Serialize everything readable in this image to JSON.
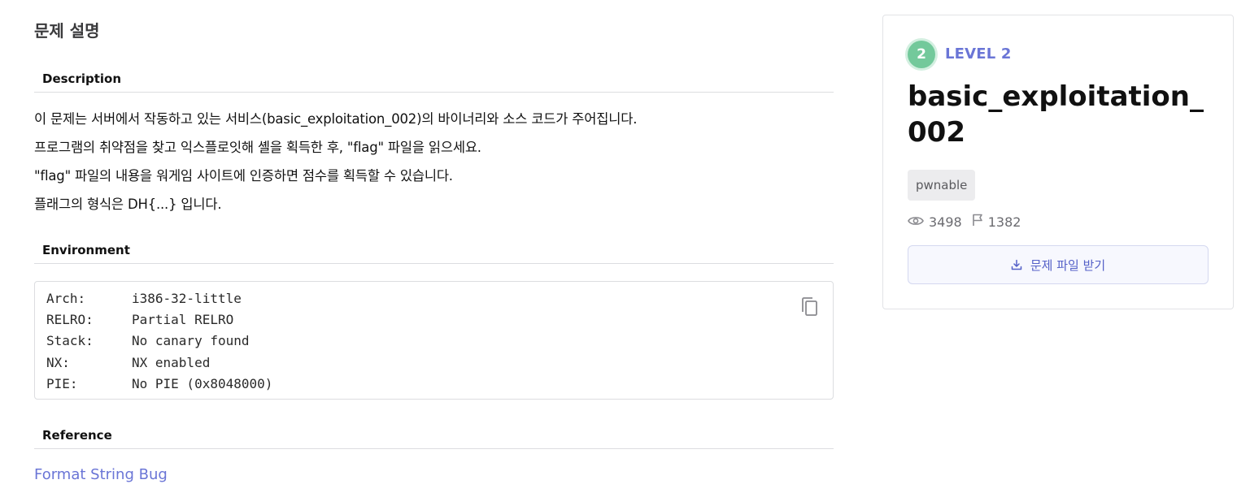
{
  "page": {
    "title": "문제 설명"
  },
  "sections": {
    "description_heading": "Description",
    "environment_heading": "Environment",
    "reference_heading": "Reference"
  },
  "description": [
    "이 문제는 서버에서 작동하고 있는 서비스(basic_exploitation_002)의 바이너리와 소스 코드가 주어집니다.",
    "프로그램의 취약점을 찾고 익스플로잇해 셸을 획득한 후, \"flag\" 파일을 읽으세요.",
    "\"flag\" 파일의 내용을 워게임 사이트에 인증하면 점수를 획득할 수 있습니다.",
    "플래그의 형식은 DH{...} 입니다."
  ],
  "environment": [
    {
      "key": "Arch:",
      "value": "i386-32-little"
    },
    {
      "key": "RELRO:",
      "value": "Partial RELRO"
    },
    {
      "key": "Stack:",
      "value": "No canary found"
    },
    {
      "key": "NX:",
      "value": "NX enabled"
    },
    {
      "key": "PIE:",
      "value": "No PIE (0x8048000)"
    }
  ],
  "reference": {
    "link_text": "Format String Bug"
  },
  "card": {
    "level_number": "2",
    "level_label": "LEVEL 2",
    "challenge_title": "basic_exploitation_002",
    "tag": "pwnable",
    "views": "3498",
    "solves": "1382",
    "download_label": "문제 파일 받기"
  },
  "colors": {
    "accent": "#6a75d6",
    "level_green": "#73c99b",
    "border": "#dcdde0"
  },
  "icons": {
    "copy": "copy-icon",
    "views": "eye-icon",
    "solves": "flag-icon",
    "download": "download-icon"
  }
}
